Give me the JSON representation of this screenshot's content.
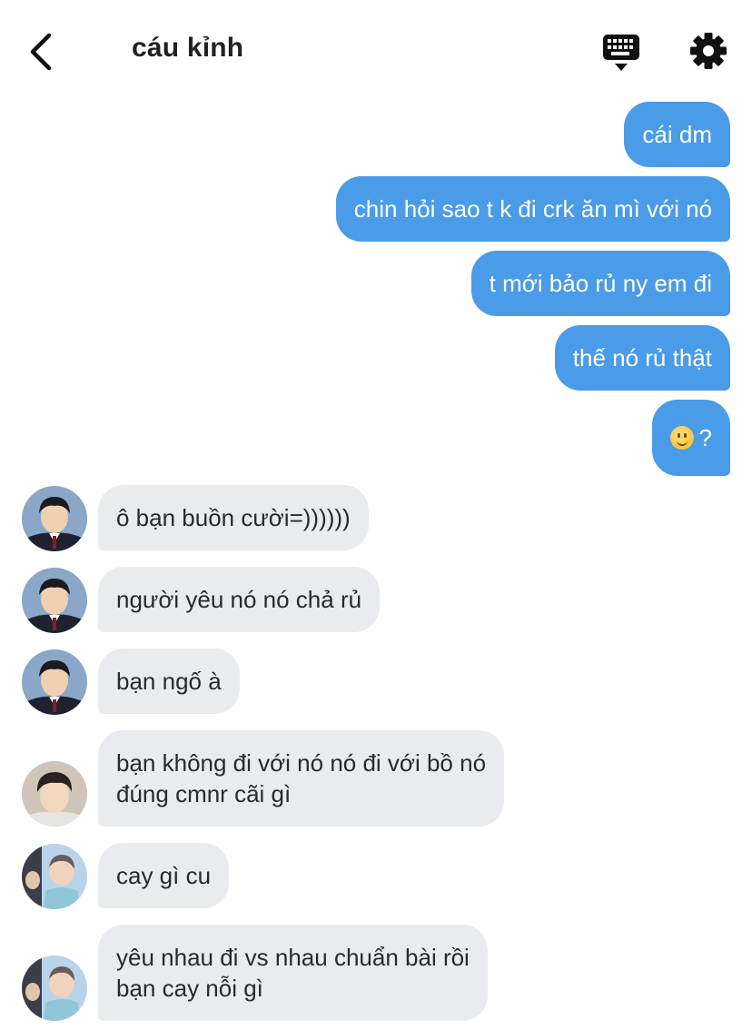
{
  "header": {
    "title": "cáu kỉnh",
    "back_icon": "chevron-left-icon",
    "keyboard_icon": "keyboard-icon",
    "settings_icon": "gear-icon"
  },
  "colors": {
    "outgoing_bubble": "#4a9be8",
    "incoming_bubble": "#e9ebef"
  },
  "outgoing": [
    {
      "text": "cái dm"
    },
    {
      "text": "chin hỏi sao t k đi crk ăn mì với nó"
    },
    {
      "text": "t mới bảo rủ ny em đi"
    },
    {
      "text": "thế nó rủ thật"
    },
    {
      "text": "?",
      "emoji": "slightly-smiling-face"
    }
  ],
  "incoming": [
    {
      "text": "ô bạn buồn cười=))))))",
      "avatar": "avatar-boy-uniform"
    },
    {
      "text": "người yêu nó nó chả rủ",
      "avatar": "avatar-boy-uniform"
    },
    {
      "text": "bạn ngố à",
      "avatar": "avatar-boy-uniform"
    },
    {
      "text": "bạn không đi với nó nó đi với bồ nó\nđúng cmnr cãi gì",
      "avatar": "avatar-boy-selfie"
    },
    {
      "text": "cay gì cu",
      "avatar": "avatar-group-photo"
    },
    {
      "text": "yêu nhau đi vs nhau chuẩn bài rồi\nbạn cay nỗi gì",
      "avatar": "avatar-group-photo"
    }
  ]
}
